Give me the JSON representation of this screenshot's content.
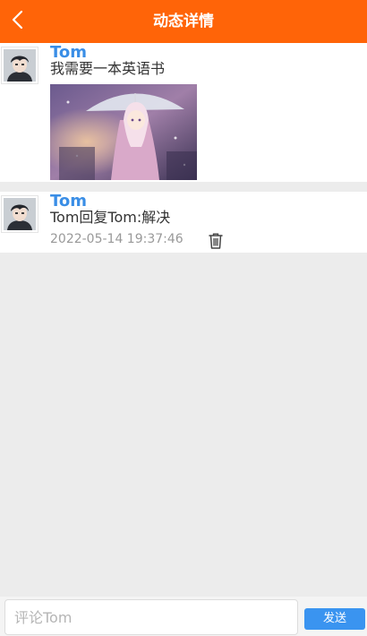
{
  "header": {
    "title": "动态详情",
    "background_color": "#ff6408",
    "back_icon": "chevron-left-icon"
  },
  "post": {
    "username": "Tom",
    "content": "我需要一本英语书",
    "avatar_icon": "user-avatar",
    "image": "anime-girl-umbrella-illustration"
  },
  "comments": [
    {
      "username": "Tom",
      "content": "Tom回复Tom:解决",
      "timestamp": "2022-05-14 19:37:46",
      "delete_icon": "trash-icon"
    }
  ],
  "comment_bar": {
    "placeholder": "评论Tom",
    "send_label": "发送",
    "send_color": "#3a94f0"
  },
  "colors": {
    "username": "#3a8ee6",
    "background": "#ececec"
  }
}
